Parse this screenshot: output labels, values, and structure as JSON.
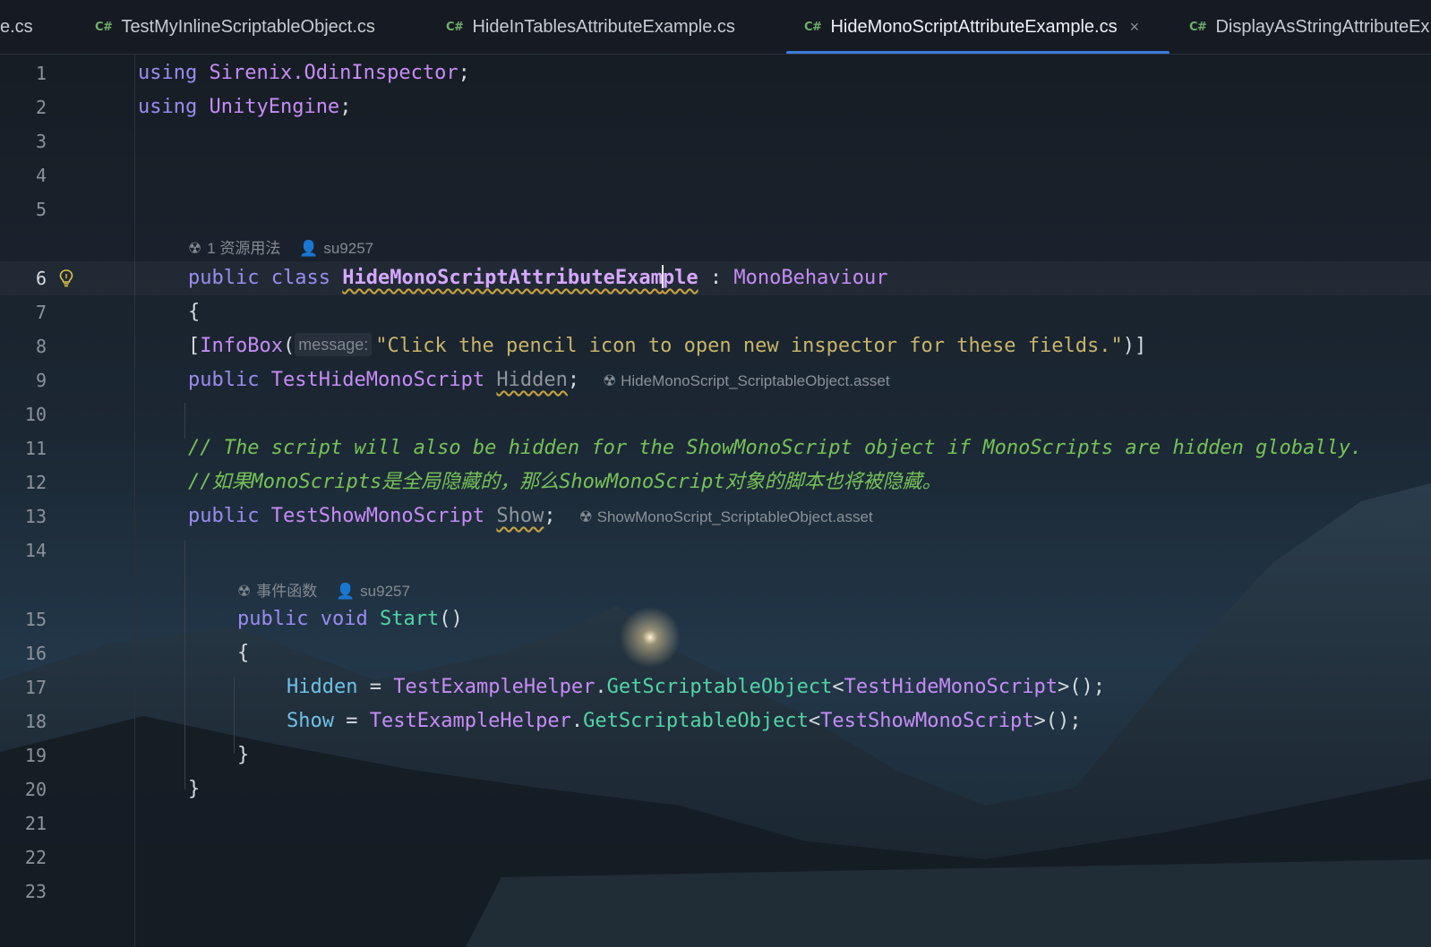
{
  "tabs": [
    {
      "label": "e.cs",
      "active": false
    },
    {
      "label": "TestMyInlineScriptableObject.cs",
      "active": false
    },
    {
      "label": "HideInTablesAttributeExample.cs",
      "active": false
    },
    {
      "label": "HideMonoScriptAttributeExample.cs",
      "active": true
    },
    {
      "label": "DisplayAsStringAttributeEx",
      "active": false
    }
  ],
  "icons": {
    "tab_file": "csharp-file-icon",
    "tab_close": "close-icon",
    "usages": "usages-icon",
    "author": "user-icon",
    "asset": "unity-asset-icon",
    "intention": "lightbulb-icon"
  },
  "glyphs": {
    "cs": "C#",
    "close": "×",
    "usages": "☢",
    "author": "👤"
  },
  "code_lens": {
    "class_usages": "1 资源用法",
    "class_author": "su9257",
    "start_usages": "事件函数",
    "start_author": "su9257"
  },
  "line_numbers": [
    "1",
    "2",
    "3",
    "4",
    "5",
    "6",
    "7",
    "8",
    "9",
    "10",
    "11",
    "12",
    "13",
    "14",
    "15",
    "16",
    "17",
    "18",
    "19",
    "20",
    "21",
    "22",
    "23"
  ],
  "code": {
    "l1_kw": "using",
    "l1_ns": "Sirenix.OdinInspector",
    "l1_end": ";",
    "l2_kw": "using",
    "l2_ns": "UnityEngine",
    "l2_end": ";",
    "l6_kw1": "public",
    "l6_kw2": "class",
    "l6_name_a": "HideMonoScriptAttributeExam",
    "l6_name_b": "ple",
    "l6_colon": " : ",
    "l6_base": "MonoBehaviour",
    "l7_brace": "{",
    "l8_open": "[",
    "l8_attr": "InfoBox",
    "l8_paren": "(",
    "l8_param_hint": "message:",
    "l8_string": "\"Click the pencil icon to open new inspector for these fields.\"",
    "l8_close": ")]",
    "l9_kw": "public",
    "l9_type": "TestHideMonoScript",
    "l9_field": "Hidden",
    "l9_end": ";",
    "l9_inlay": "HideMonoScript_ScriptableObject.asset",
    "l11_comment": "// The script will also be hidden for the ShowMonoScript object if MonoScripts are hidden globally.",
    "l12_comment": "//如果MonoScripts是全局隐藏的，那么ShowMonoScript对象的脚本也将被隐藏。",
    "l13_kw": "public",
    "l13_type": "TestShowMonoScript",
    "l13_field": "Show",
    "l13_end": ";",
    "l13_inlay": "ShowMonoScript_ScriptableObject.asset",
    "l15_kw1": "public",
    "l15_kw2": "void",
    "l15_fn": "Start",
    "l15_parens": "()",
    "l16_brace": "{",
    "l17_field": "Hidden",
    "l17_eq": " = ",
    "l17_helper": "TestExampleHelper",
    "l17_dot": ".",
    "l17_method": "GetScriptableObject",
    "l17_lt": "<",
    "l17_type": "TestHideMonoScript",
    "l17_end": ">();",
    "l18_field": "Show",
    "l18_eq": " = ",
    "l18_helper": "TestExampleHelper",
    "l18_dot": ".",
    "l18_method": "GetScriptableObject",
    "l18_lt": "<",
    "l18_type": "TestShowMonoScript",
    "l18_end": ">();",
    "l19_brace": "}",
    "l20_brace": "}"
  },
  "colors": {
    "keyword": "#9a8cf0",
    "type": "#c78cf7",
    "method": "#52d4a6",
    "string": "#c9b56a",
    "comment": "#76c257",
    "field": "#6fc2e8",
    "tab_accent": "#3b7ddd",
    "csharp_icon": "#6fb06a"
  }
}
